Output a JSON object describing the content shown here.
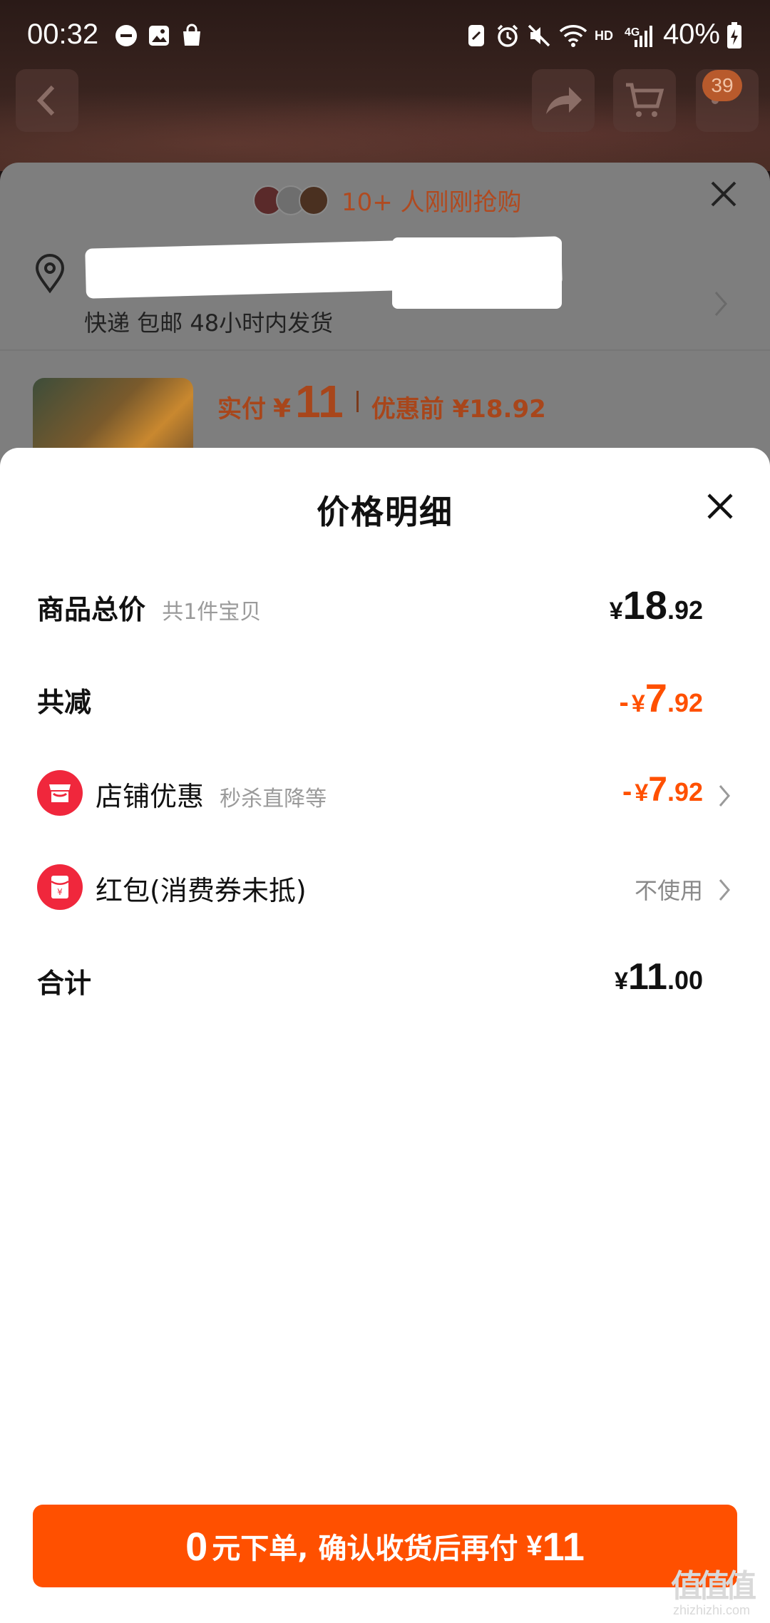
{
  "status_bar": {
    "time": "00:32",
    "battery": "40%",
    "network": "HD",
    "signal": "4G",
    "icons": [
      "minus-circle-icon",
      "image-icon",
      "shopping-bag-icon",
      "nfc-icon",
      "alarm-icon",
      "mute-icon",
      "wifi-icon",
      "signal-icon",
      "battery-charging-icon"
    ]
  },
  "top_nav": {
    "cart_count": "39",
    "icons": [
      "back-icon",
      "share-icon",
      "cart-icon"
    ]
  },
  "order_panel": {
    "buyers_text": "10+ 人刚刚抢购",
    "shipping_text": "快递 包邮 48小时内发货",
    "paid_label": "实付",
    "paid_yen": "¥",
    "paid_amount": "11",
    "pre_discount_label": "优惠前 ¥18.92"
  },
  "price_detail": {
    "title": "价格明细",
    "goods_total": {
      "label": "商品总价",
      "sub": "共1件宝贝",
      "yen": "¥",
      "int": "18",
      "dec": ".92"
    },
    "total_reduction": {
      "label": "共减",
      "minus": "-",
      "yen": "¥",
      "int": "7",
      "dec": ".92"
    },
    "shop_discount": {
      "label": "店铺优惠",
      "sub": "秒杀直降等",
      "minus": "-",
      "yen": "¥",
      "int": "7",
      "dec": ".92"
    },
    "red_packet": {
      "label": "红包(消费券未抵)",
      "value": "不使用"
    },
    "total": {
      "label": "合计",
      "yen": "¥",
      "int": "11",
      "dec": ".00"
    }
  },
  "cta": {
    "zero": "0",
    "text": "元下单, 确认收货后再付",
    "yen": "¥",
    "amount": "11"
  },
  "watermark": {
    "logo": "值值值",
    "url": "zhizhizhi.com"
  },
  "colors": {
    "accent": "#ff5000",
    "shop_icon": "#f0273c",
    "text": "#111111",
    "muted": "#9a9a9a"
  }
}
